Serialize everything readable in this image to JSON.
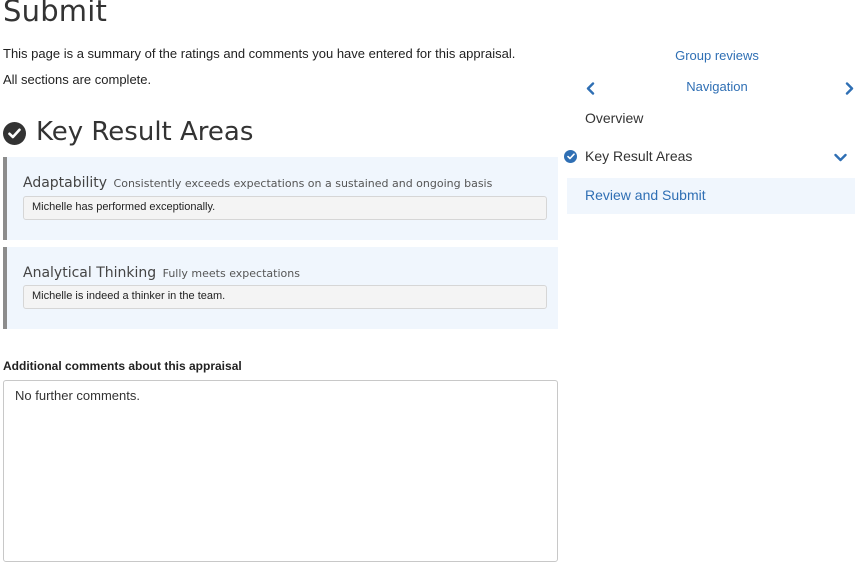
{
  "page": {
    "title": "Submit",
    "summary": "This page is a summary of the ratings and comments you have entered for this appraisal.",
    "status": "All sections are complete."
  },
  "section": {
    "icon": "check-circle-icon",
    "title": "Key Result Areas",
    "items": [
      {
        "name": "Adaptability",
        "rating": "Consistently exceeds expectations on a sustained and ongoing basis",
        "comment": "Michelle has performed exceptionally."
      },
      {
        "name": "Analytical Thinking",
        "rating": "Fully meets expectations",
        "comment": "Michelle is indeed a thinker in the team."
      }
    ]
  },
  "additional": {
    "label": "Additional comments about this appraisal",
    "value": "No further comments."
  },
  "sidebar": {
    "group_reviews": "Group reviews",
    "nav_title": "Navigation",
    "prev_icon": "chevron-left-icon",
    "next_icon": "chevron-right-icon",
    "items": [
      {
        "label": "Overview"
      },
      {
        "label": "Key Result Areas",
        "icon": "check-circle-icon",
        "expand_icon": "chevron-down-icon"
      },
      {
        "label": "Review and Submit"
      }
    ]
  },
  "colors": {
    "accent": "#2f6fb4",
    "card_bg": "#f0f6fd",
    "card_border": "#8c8c8c",
    "heading": "#333333"
  }
}
